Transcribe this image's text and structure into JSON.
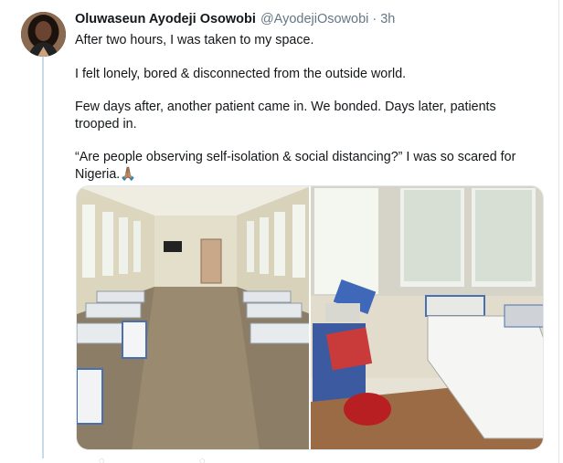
{
  "tweet": {
    "display_name": "Oluwaseun Ayodeji Osowobi",
    "handle": "@AyodejiOsowobi",
    "separator": "·",
    "time": "3h",
    "paragraphs": [
      "After two hours, I was taken to my space.",
      "I felt lonely, bored & disconnected from the outside world.",
      "Few days after, another patient came in. We bonded. Days later, patients trooped in.",
      "“Are people observing self-isolation & social distancing?” I was so scared for Nigeria.🙏🏽"
    ],
    "media": {
      "left_photo": "hospital-ward-photo",
      "right_photo": "hospital-bed-photo"
    }
  },
  "icons": {
    "avatar": "profile-avatar",
    "reply": "reply-icon",
    "like": "like-icon"
  },
  "colors": {
    "text": "#14171a",
    "secondary": "#657786",
    "thread_line": "#c9dbe7",
    "border": "#e1e8ed"
  }
}
